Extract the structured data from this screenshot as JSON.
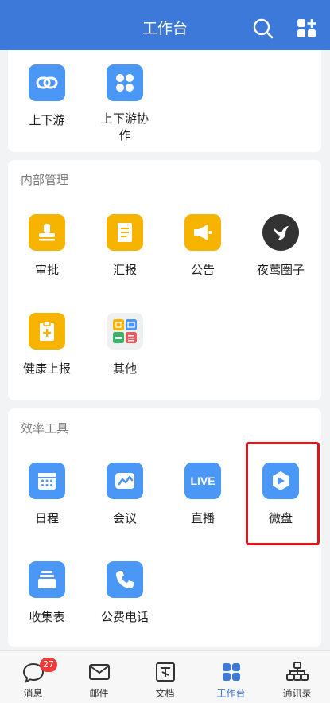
{
  "header": {
    "title": "工作台"
  },
  "upstream": {
    "items": [
      {
        "label": "上下游",
        "icon": "link-icon"
      },
      {
        "label": "上下游协\n作",
        "icon": "apps-grid-icon"
      }
    ]
  },
  "internal": {
    "title": "内部管理",
    "items": [
      {
        "label": "审批",
        "icon": "stamp-icon"
      },
      {
        "label": "汇报",
        "icon": "report-doc-icon"
      },
      {
        "label": "公告",
        "icon": "megaphone-icon"
      },
      {
        "label": "夜莺圈子",
        "icon": "nightingale-icon"
      },
      {
        "label": "健康上报",
        "icon": "health-clipboard-icon"
      },
      {
        "label": "其他",
        "icon": "other-apps-icon"
      }
    ]
  },
  "tools": {
    "title": "效率工具",
    "items": [
      {
        "label": "日程",
        "icon": "calendar-icon"
      },
      {
        "label": "会议",
        "icon": "meeting-icon"
      },
      {
        "label": "直播",
        "icon": "live-icon",
        "badge_text": "LIVE"
      },
      {
        "label": "微盘",
        "icon": "cloud-drive-icon"
      },
      {
        "label": "收集表",
        "icon": "form-stack-icon"
      },
      {
        "label": "公费电话",
        "icon": "phone-icon"
      }
    ]
  },
  "tabbar": {
    "tabs": [
      {
        "label": "消息",
        "icon": "chat-bubble-icon",
        "badge": "27"
      },
      {
        "label": "邮件",
        "icon": "mail-icon"
      },
      {
        "label": "文档",
        "icon": "document-icon"
      },
      {
        "label": "工作台",
        "icon": "workbench-grid-icon",
        "active": true
      },
      {
        "label": "通讯录",
        "icon": "org-chart-icon"
      }
    ]
  },
  "colors": {
    "header": "#3c79d9",
    "app_blue": "#4b97f5",
    "app_orange": "#f6b400",
    "highlight_red": "#e0141b",
    "badge_red": "#ec3b3b"
  }
}
